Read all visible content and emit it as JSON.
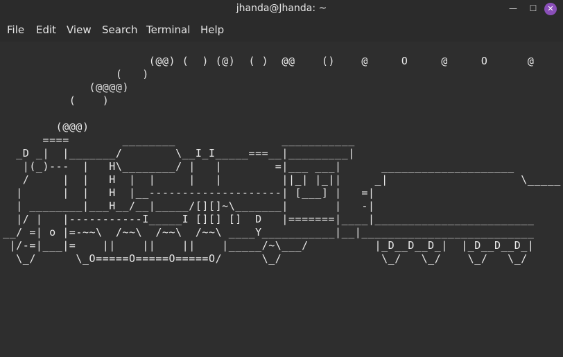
{
  "window": {
    "title": "jhanda@Jhanda: ~",
    "minimize": "—",
    "maximize": "☐",
    "close": "✕"
  },
  "menu": {
    "file": "File",
    "edit": "Edit",
    "view": "View",
    "search": "Search",
    "terminal": "Terminal",
    "help": "Help"
  },
  "terminal": {
    "output": "                      (@@) (  ) (@)  ( )  @@    ()    @     O     @     O      @\n                 (   )\n             (@@@@)\n          (    )\n\n        (@@@)\n      ====        ________                ___________\n  _D _|  |_______/        \\__I_I_____===__|_________|\n   |(_)---  |   H\\________/ |   |        =|___ ___|      ____________________\n   /     |  |   H  |  |     |   |         ||_| |_||     _|                    \\_____\n  |      |  |   H  |__--------------------| [___] |   =|\n  | ________|___H__/__|_____/[][]~\\_______|       |   -|\n  |/ |   |-----------I_____I [][] []  D   |=======|____|________________________\n__/ =| o |=-~~\\  /~~\\  /~~\\  /~~\\ ____Y___________|__|__________________________\n |/-=|___|=    ||    ||    ||    |_____/~\\___/          |_D__D__D_|  |_D__D__D_|\n  \\_/      \\_O=====O=====O=====O/      \\_/               \\_/   \\_/    \\_/   \\_/"
  }
}
